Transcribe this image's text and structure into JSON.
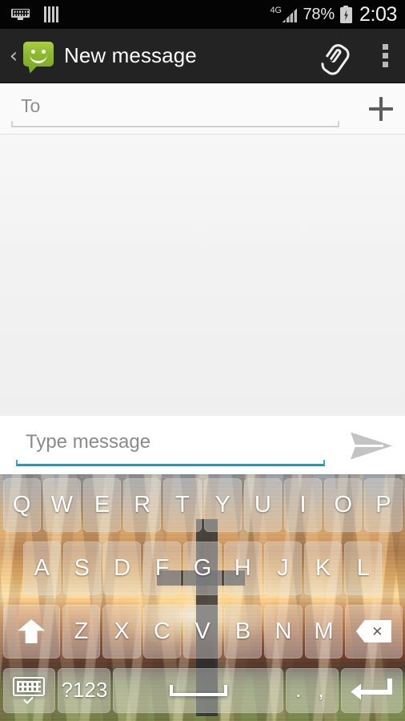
{
  "status_bar": {
    "left_icons": [
      {
        "name": "keyboard-active-icon",
        "label": "keyboard"
      },
      {
        "name": "signal-bars-icon",
        "label": "bars"
      }
    ],
    "network_type": "4G",
    "battery_percent": "78%",
    "battery_icon": "battery-charging-icon",
    "time": "2:03"
  },
  "action_bar": {
    "back_label": "‹",
    "app_icon": "messaging-app-icon",
    "title": "New message",
    "attach_icon": "paperclip-icon",
    "overflow_icon": "overflow-menu-icon"
  },
  "recipient": {
    "placeholder": "To",
    "value": "",
    "add_contact_icon": "plus-icon"
  },
  "compose": {
    "placeholder": "Type message",
    "value": "",
    "send_icon": "send-icon",
    "underline_color": "#2196c8"
  },
  "keyboard": {
    "theme": "sunset-cross-photo",
    "rows": [
      {
        "id": "row1",
        "keys": [
          {
            "label": "Q",
            "name": "key-q"
          },
          {
            "label": "W",
            "name": "key-w"
          },
          {
            "label": "E",
            "name": "key-e"
          },
          {
            "label": "R",
            "name": "key-r"
          },
          {
            "label": "T",
            "name": "key-t"
          },
          {
            "label": "Y",
            "name": "key-y"
          },
          {
            "label": "U",
            "name": "key-u"
          },
          {
            "label": "I",
            "name": "key-i"
          },
          {
            "label": "O",
            "name": "key-o"
          },
          {
            "label": "P",
            "name": "key-p"
          }
        ]
      },
      {
        "id": "row2",
        "keys": [
          {
            "label": "A",
            "name": "key-a"
          },
          {
            "label": "S",
            "name": "key-s"
          },
          {
            "label": "D",
            "name": "key-d"
          },
          {
            "label": "F",
            "name": "key-f"
          },
          {
            "label": "G",
            "name": "key-g"
          },
          {
            "label": "H",
            "name": "key-h"
          },
          {
            "label": "J",
            "name": "key-j"
          },
          {
            "label": "K",
            "name": "key-k"
          },
          {
            "label": "L",
            "name": "key-l"
          }
        ]
      },
      {
        "id": "row3",
        "keys": [
          {
            "label": "",
            "name": "key-shift",
            "icon": "shift-arrow-icon"
          },
          {
            "label": "Z",
            "name": "key-z"
          },
          {
            "label": "X",
            "name": "key-x"
          },
          {
            "label": "C",
            "name": "key-c"
          },
          {
            "label": "V",
            "name": "key-v"
          },
          {
            "label": "B",
            "name": "key-b"
          },
          {
            "label": "N",
            "name": "key-n"
          },
          {
            "label": "M",
            "name": "key-m"
          },
          {
            "label": "",
            "name": "key-backspace",
            "icon": "backspace-icon"
          }
        ]
      },
      {
        "id": "row4",
        "keys": [
          {
            "label": "",
            "name": "key-hide-keyboard",
            "icon": "keyboard-hide-icon"
          },
          {
            "label": "?123",
            "name": "key-symbols"
          },
          {
            "label": "",
            "name": "key-space",
            "icon": "spacebar-icon"
          },
          {
            "label": ". ,",
            "name": "key-period-comma"
          },
          {
            "label": "",
            "name": "key-enter",
            "icon": "enter-arrow-icon"
          }
        ]
      }
    ]
  }
}
